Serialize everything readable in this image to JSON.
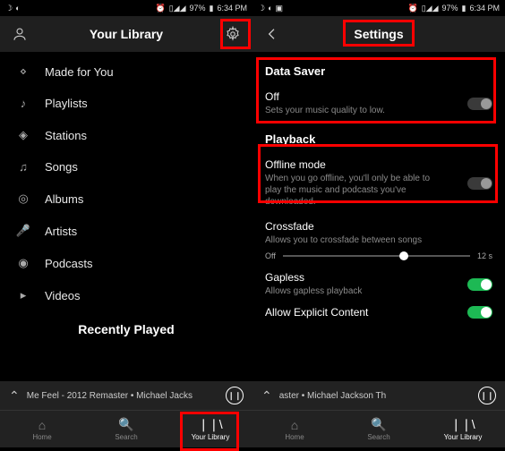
{
  "statusbar": {
    "battery": "97%",
    "time": "6:34 PM"
  },
  "left": {
    "title": "Your Library",
    "items": [
      {
        "icon": "sparkle",
        "label": "Made for You"
      },
      {
        "icon": "note",
        "label": "Playlists"
      },
      {
        "icon": "radio",
        "label": "Stations"
      },
      {
        "icon": "song",
        "label": "Songs"
      },
      {
        "icon": "album",
        "label": "Albums"
      },
      {
        "icon": "mic",
        "label": "Artists"
      },
      {
        "icon": "pod",
        "label": "Podcasts"
      },
      {
        "icon": "video",
        "label": "Videos"
      }
    ],
    "section": "Recently Played"
  },
  "right": {
    "title": "Settings",
    "dataSaver": {
      "heading": "Data Saver",
      "state": "Off",
      "desc": "Sets your music quality to low."
    },
    "playback": {
      "heading": "Playback",
      "offline": {
        "title": "Offline mode",
        "desc": "When you go offline, you'll only be able to play the music and podcasts you've downloaded."
      },
      "crossfade": {
        "title": "Crossfade",
        "desc": "Allows you to crossfade between songs",
        "left": "Off",
        "right": "12 s"
      },
      "gapless": {
        "title": "Gapless",
        "desc": "Allows gapless playback"
      },
      "explicit": {
        "title": "Allow Explicit Content"
      }
    }
  },
  "nowplaying": {
    "left": "Me Feel - 2012 Remaster • Michael Jacks",
    "right": "aster • Michael Jackson          Th"
  },
  "nav": {
    "home": "Home",
    "search": "Search",
    "library": "Your Library"
  }
}
